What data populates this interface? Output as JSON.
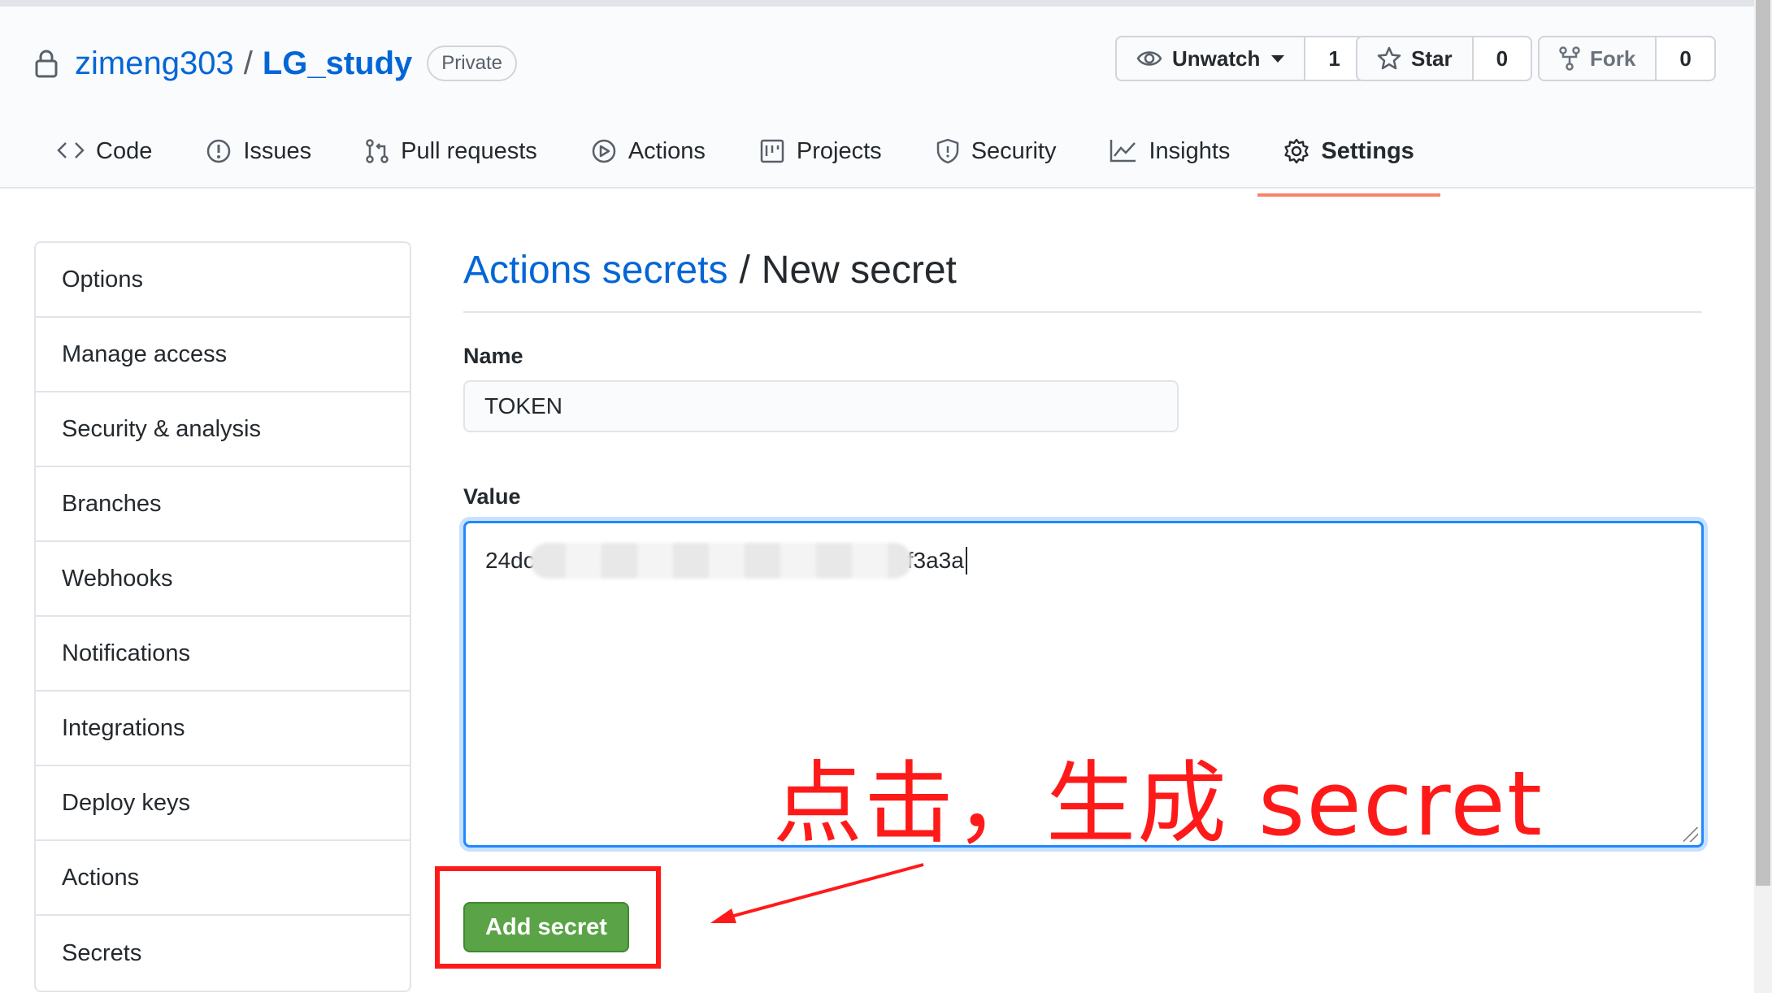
{
  "header": {
    "owner": "zimeng303",
    "separator": "/",
    "repo": "LG_study",
    "badge": "Private",
    "watch": {
      "label": "Unwatch",
      "count": "1"
    },
    "star": {
      "label": "Star",
      "count": "0"
    },
    "fork": {
      "label": "Fork",
      "count": "0"
    }
  },
  "tabs": [
    {
      "label": "Code",
      "icon": "code-icon"
    },
    {
      "label": "Issues",
      "icon": "issue-icon"
    },
    {
      "label": "Pull requests",
      "icon": "pull-request-icon"
    },
    {
      "label": "Actions",
      "icon": "play-icon"
    },
    {
      "label": "Projects",
      "icon": "project-icon"
    },
    {
      "label": "Security",
      "icon": "shield-icon"
    },
    {
      "label": "Insights",
      "icon": "graph-icon"
    },
    {
      "label": "Settings",
      "icon": "gear-icon",
      "selected": true
    }
  ],
  "sidebar": {
    "items": [
      {
        "label": "Options"
      },
      {
        "label": "Manage access"
      },
      {
        "label": "Security & analysis"
      },
      {
        "label": "Branches"
      },
      {
        "label": "Webhooks"
      },
      {
        "label": "Notifications"
      },
      {
        "label": "Integrations"
      },
      {
        "label": "Deploy keys"
      },
      {
        "label": "Actions"
      },
      {
        "label": "Secrets"
      }
    ]
  },
  "main": {
    "breadcrumb_link": "Actions secrets",
    "breadcrumb_sep": "/",
    "title": "New secret",
    "name_label": "Name",
    "name_value": "TOKEN",
    "value_label": "Value",
    "value_prefix": "24dc",
    "value_suffix": "f3a3a",
    "annotation": "点击，生成 secret",
    "submit_label": "Add secret"
  },
  "colors": {
    "link": "#0366d6",
    "selected_tab_underline": "#f9826c",
    "primary_button": "#5aa447",
    "annotation_red": "#ff1a1a",
    "focus_border": "#2188ff"
  }
}
